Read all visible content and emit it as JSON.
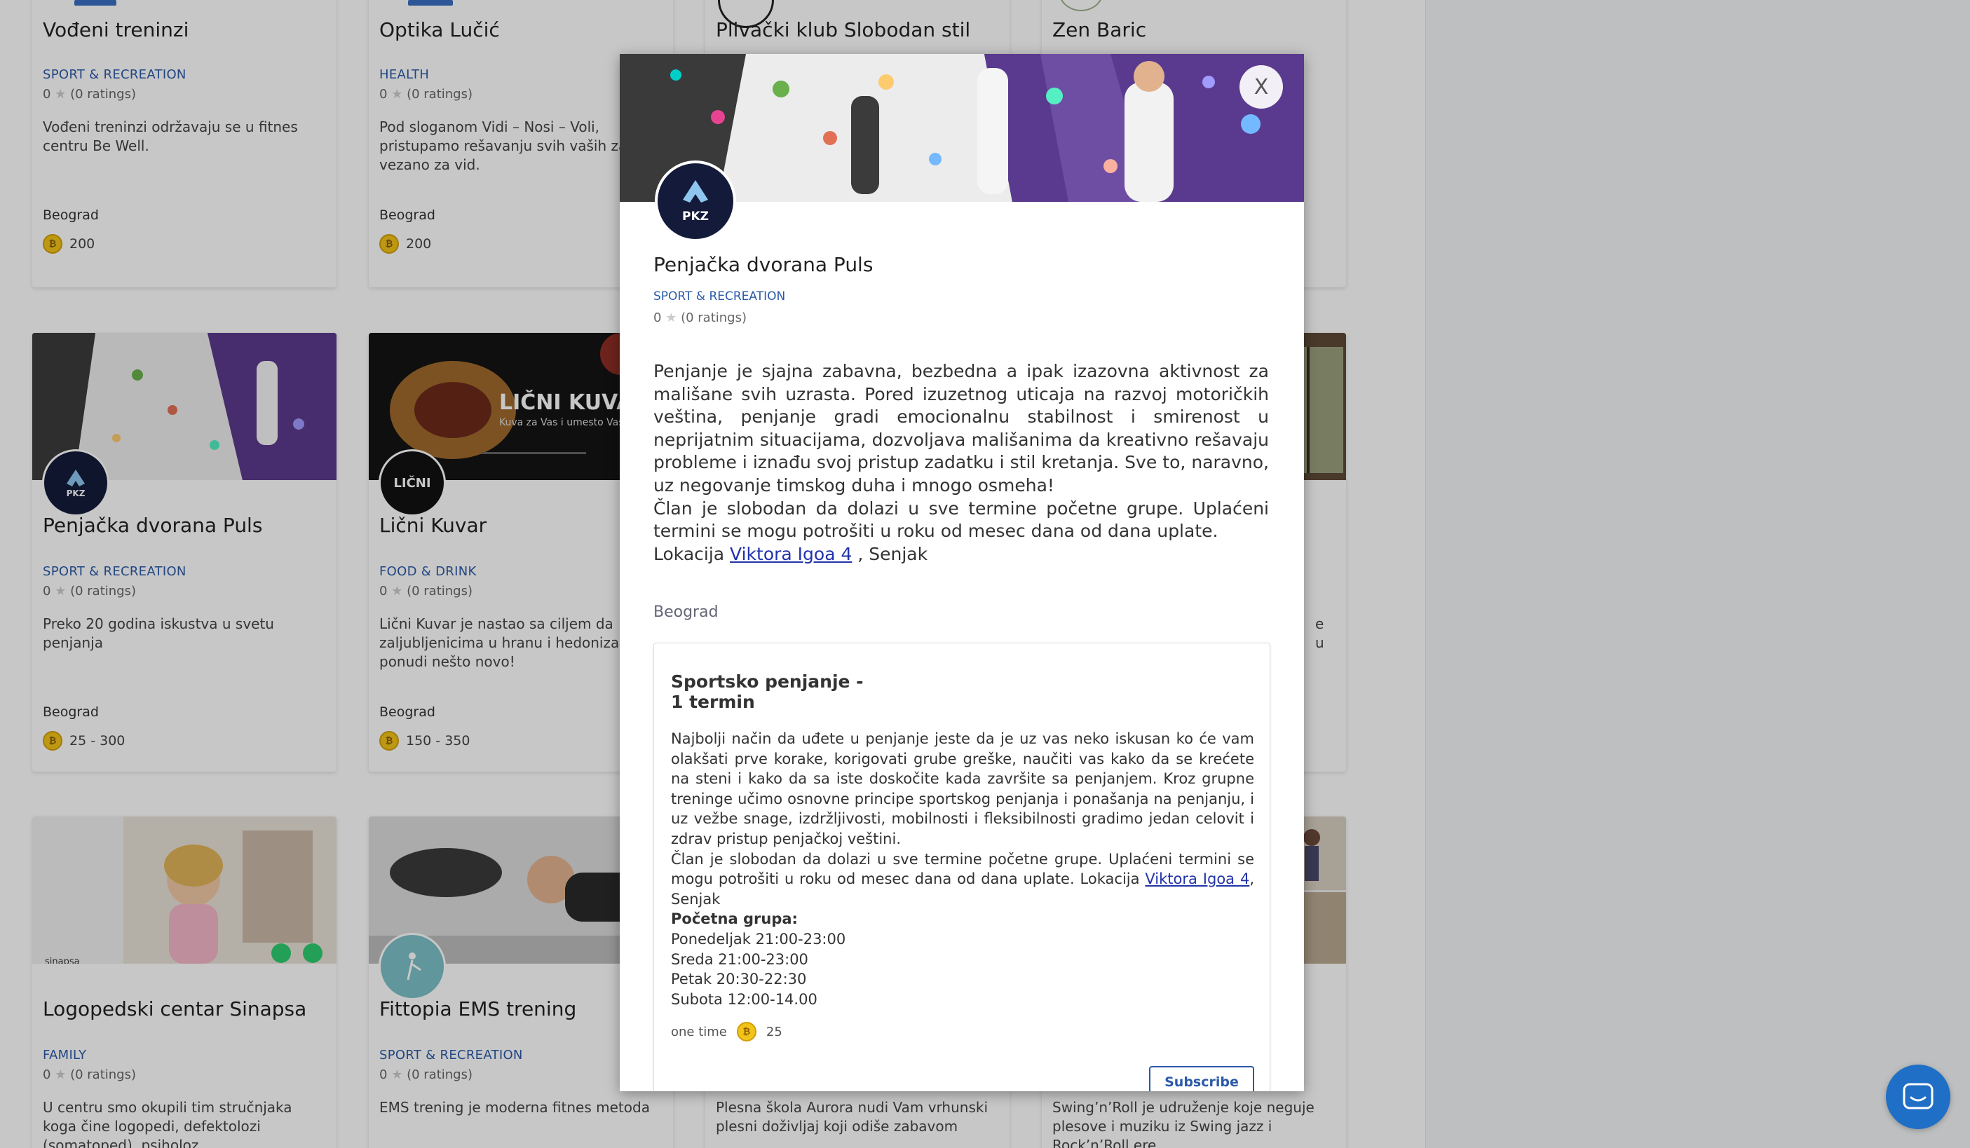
{
  "colors": {
    "accent": "#2b5aa8",
    "coin": "#f2c419",
    "chat": "#1e6fc5",
    "overlay": "rgba(0,0,0,0.22)"
  },
  "cards": {
    "vodjeni": {
      "title": "Vođeni treninzi",
      "category": "SPORT & RECREATION",
      "rating": "0",
      "ratings_count": "(0 ratings)",
      "description": "Vođeni treninzi održavaju se u fitnes centru Be Well.",
      "city": "Beograd",
      "price": "200"
    },
    "optika": {
      "title": "Optika Lučić",
      "category": "HEALTH",
      "rating": "0",
      "ratings_count": "(0 ratings)",
      "description": "Pod sloganom Vidi – Nosi – Voli, pristupamo rešavanju svih vaših za vezano za vid.",
      "city": "Beograd",
      "price": "200"
    },
    "plivacki": {
      "title": "Plivački klub Slobodan stil"
    },
    "zen": {
      "title": "Zen Baric"
    },
    "puls": {
      "title": "Penjačka dvorana Puls",
      "category": "SPORT & RECREATION",
      "rating": "0",
      "ratings_count": "(0 ratings)",
      "description": "Preko 20 godina iskustva u svetu penjanja",
      "city": "Beograd",
      "price": "25 - 300"
    },
    "kuvar": {
      "title": "Lični Kuvar",
      "banner_text": "LIČNI KUVAR",
      "banner_sub": "Kuva za Vas i umesto Vas",
      "logo_text": "LIČNI",
      "category": "FOOD & DRINK",
      "rating": "0",
      "ratings_count": "(0 ratings)",
      "description": "Lični Kuvar je nastao sa ciljem da zaljubljenicima u hranu i hedonizam ponudi nešto novo!",
      "city": "Beograd",
      "price": "150 - 350"
    },
    "sinapsa": {
      "title": "Logopedski centar Sinapsa",
      "logo_text": "sinapsa",
      "category": "FAMILY",
      "rating": "0",
      "ratings_count": "(0 ratings)",
      "description": "U centru smo okupili tim stručnjaka koga čine logopedi, defektolozi (somatoped), psiholoz"
    },
    "fittopia": {
      "title": "Fittopia EMS trening",
      "category": "SPORT & RECREATION",
      "rating": "0",
      "ratings_count": "(0 ratings)",
      "description": "EMS trening je moderna fitnes metoda"
    },
    "aurora": {
      "description": "Plesna škola Aurora nudi Vam vrhunski plesni doživljaj koji odiše zabavom"
    },
    "swing": {
      "description": "Swing’n’Roll je udruženje koje neguje plesove i muziku iz Swing jazz i Rock’n’Roll ere"
    },
    "partial_right_desc": "e u"
  },
  "modal": {
    "close_label": "X",
    "logo_text": "PKZ",
    "title": "Penjačka dvorana Puls",
    "category": "SPORT & RECREATION",
    "rating": "0",
    "ratings_count": "(0 ratings)",
    "description_p1": "Penjanje je sjajna zabavna, bezbedna a ipak izazovna aktivnost za mališane svih uzrasta. Pored izuzetnog uticaja na razvoj motoričkih veština, penjanje gradi emocionalnu stabilnost i smirenost u neprijatnim situacijama, dozvoljava mališanima da kreativno rešavaju probleme i iznađu svoj pristup zadatku i stil kretanja. Sve to, naravno, uz negovanje timskog duha i mnogo osmeha!",
    "description_p2": "Član je slobodan da dolazi u sve termine početne grupe. Uplaćeni termini se mogu potrošiti u roku od mesec dana od dana uplate.",
    "location_prefix": "Lokacija ",
    "location_link": "Viktora Igoa 4",
    "location_suffix": " , Senjak",
    "city": "Beograd",
    "plan": {
      "title": "Sportsko penjanje - 1 termin",
      "desc_p1": "Najbolji način da uđete u penjanje jeste da je uz vas neko iskusan ko će vam olakšati prve korake, korigovati grube greške, naučiti vas kako da se krećete na steni i kako da sa iste doskočite kada završite sa penjanjem. Kroz grupne treninge učimo osnovne principe sportskog penjanja i ponašanja na penjanju, i uz vežbe snage, izdržljivosti, mobilnosti i fleksibilnosti gradimo jedan celovit i zdrav pristup penjačkoj veštini.",
      "desc_p2_prefix": "Član je slobodan da dolazi u sve termine početne grupe. Uplaćeni termini se mogu potrošiti u roku od mesec dana od dana uplate. Lokacija ",
      "desc_p2_link": "Viktora Igoa 4",
      "desc_p2_suffix": ", Senjak",
      "group_heading": "Početna grupa:",
      "schedule": [
        "Ponedeljak 21:00-23:00",
        "Sreda 21:00-23:00",
        "Petak 20:30-22:30",
        "Subota 12:00-14.00"
      ],
      "frequency": "one time",
      "price": "25",
      "subscribe_label": "Subscribe"
    }
  },
  "icons": {
    "coin": "coin-icon",
    "star": "star-icon",
    "chat": "chat-icon",
    "close": "close-icon"
  }
}
